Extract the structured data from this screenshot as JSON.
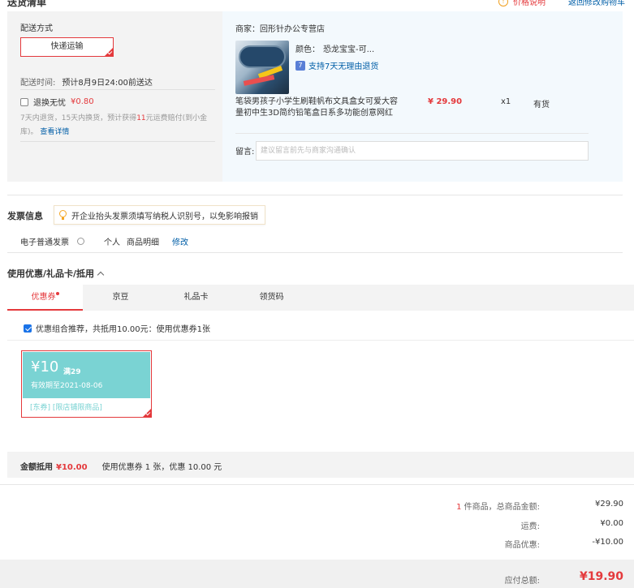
{
  "header": {
    "title": "送货清单",
    "price_note": "价格说明",
    "back_to_cart": "返回修改购物车"
  },
  "shipping": {
    "section_label": "配送方式",
    "method": "快递运输",
    "time_label": "配送时间:",
    "time_value": "预计8月9日24:00前送达",
    "worry_free_label": "退换无忧",
    "worry_free_price": "¥0.80",
    "desc_prefix": "7天内退货，15天内换货，预计获得",
    "desc_highlight": "11",
    "desc_suffix": "元运费赔付(到小金库)。",
    "detail_link": "查看详情"
  },
  "product": {
    "merchant": "商家：回形针办公专营店",
    "color_label": "颜色：",
    "color_value": "恐龙宝宝-可...",
    "return_badge": "7",
    "return_text": "支持7天无理由退货",
    "name": "笔袋男孩子小学生刷鞋帆布文具盒女可爱大容量初中生3D简约铅笔盒日系多功能创意网红",
    "price": "¥ 29.90",
    "qty": "x1",
    "stock": "有货",
    "message_label": "留言:",
    "message_placeholder": "建议留言前先与商家沟通确认"
  },
  "invoice": {
    "title": "发票信息",
    "tip": "开企业抬头发票须填写纳税人识别号，以免影响报销",
    "type": "电子普通发票",
    "holder": "个人",
    "content": "商品明细",
    "edit": "修改"
  },
  "coupons": {
    "title": "使用优惠/礼品卡/抵用",
    "tabs": [
      "优惠券",
      "京豆",
      "礼品卡",
      "领货码"
    ],
    "recommend": "优惠组合推荐，共抵用10.00元：使用优惠券1张",
    "coupon": {
      "amount": "¥10",
      "condition": "满29",
      "expiry": "有效期至2021-08-06",
      "scope": "[东券] [限店铺限商品]"
    },
    "summary_label": "金额抵用",
    "summary_amount": "¥10.00",
    "summary_text": "使用优惠券 1 张，优惠 10.00 元"
  },
  "totals": {
    "items_count": "1",
    "items_label": " 件商品，总商品金额:",
    "items_value": "¥29.90",
    "shipping_label": "运费:",
    "shipping_value": "¥0.00",
    "discount_label": "商品优惠:",
    "discount_value": "-¥10.00",
    "grand_label": "应付总额:",
    "grand_value": "¥19.90"
  },
  "colors": {
    "accent_red": "#e4393c",
    "link_blue": "#005ea7",
    "coupon_teal": "#7ad3d3"
  }
}
